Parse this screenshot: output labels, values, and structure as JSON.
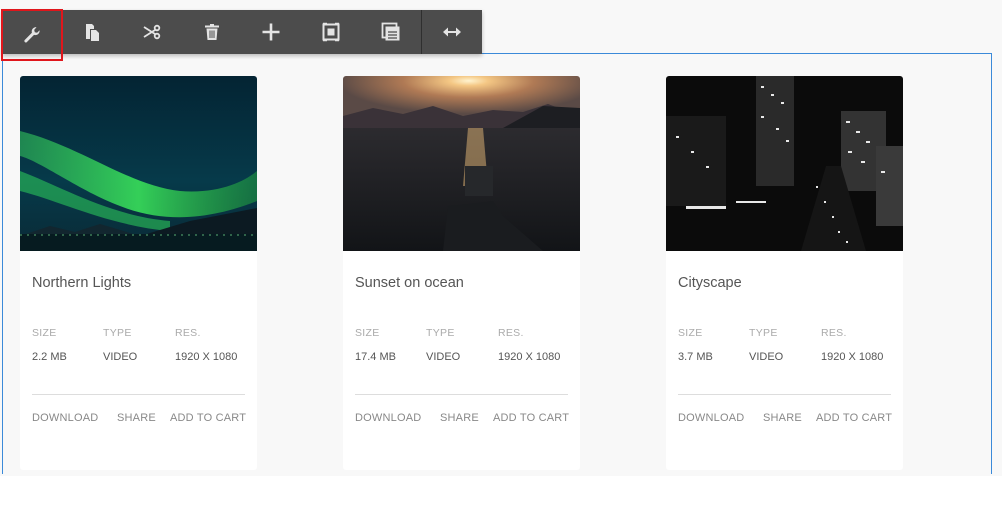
{
  "toolbar": {
    "tools": [
      {
        "name": "settings",
        "icon": "wrench-icon"
      },
      {
        "name": "copy",
        "icon": "copy-icon"
      },
      {
        "name": "cut",
        "icon": "scissors-icon"
      },
      {
        "name": "delete",
        "icon": "trash-icon"
      },
      {
        "name": "add",
        "icon": "plus-icon"
      },
      {
        "name": "select-parent",
        "icon": "select-frame-icon"
      },
      {
        "name": "layout",
        "icon": "layout-panel-icon"
      },
      {
        "name": "resize",
        "icon": "horizontal-resize-icon"
      }
    ],
    "active_color": "#e0161c",
    "background": "#4c4c4c"
  },
  "selection_color": "#3b8ad9",
  "labels": {
    "size": "SIZE",
    "type": "TYPE",
    "res": "RES.",
    "download": "DOWNLOAD",
    "share": "SHARE",
    "add_to_cart": "ADD TO CART"
  },
  "cards": [
    {
      "title": "Northern Lights",
      "size": "2.2 MB",
      "type": "VIDEO",
      "res": "1920 X 1080",
      "image": "aurora-image"
    },
    {
      "title": "Sunset on ocean",
      "size": "17.4 MB",
      "type": "VIDEO",
      "res": "1920 X 1080",
      "image": "sunset-ocean-image"
    },
    {
      "title": "Cityscape",
      "size": "3.7 MB",
      "type": "VIDEO",
      "res": "1920 X 1080",
      "image": "cityscape-image"
    }
  ]
}
